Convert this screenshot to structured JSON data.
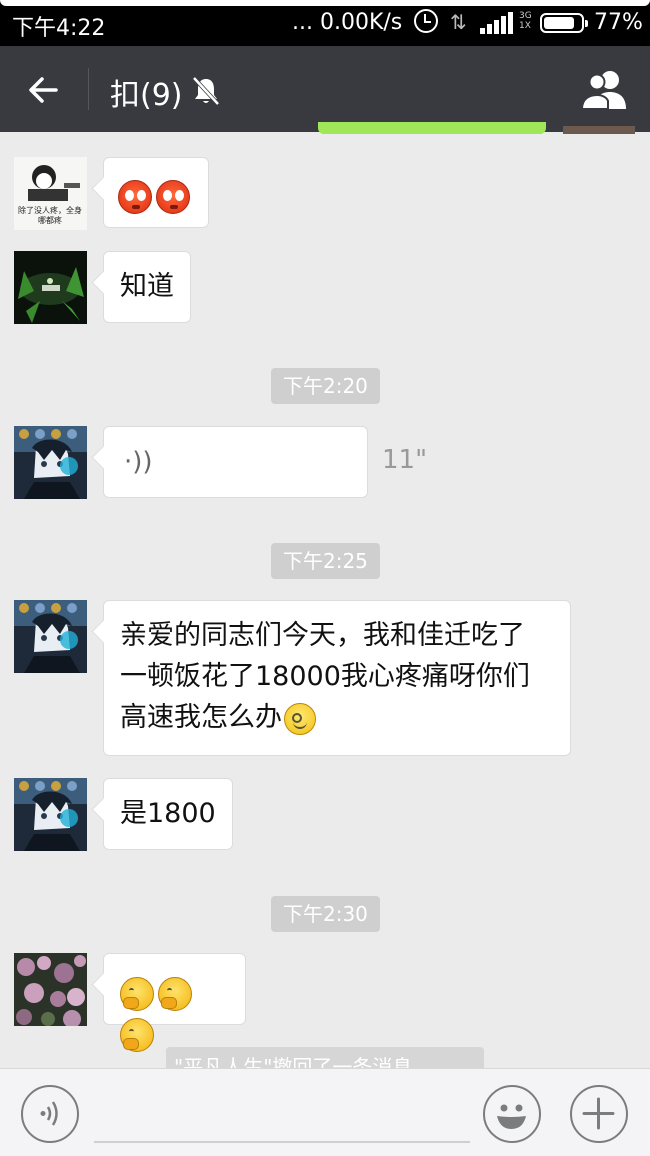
{
  "status_bar": {
    "time": "下午4:22",
    "network_speed": "... 0.00K/s",
    "network_type": "3G\n1X",
    "battery": "77%"
  },
  "header": {
    "title": "扣(9)",
    "back_icon": "back-arrow-icon",
    "mute_icon": "bell-muted-icon",
    "group_icon": "group-members-icon"
  },
  "messages": [
    {
      "type": "emoji",
      "emojis": [
        "blush-icon",
        "blush-icon"
      ],
      "avatar_caption": "除了没人疼，全身\n哪都疼"
    },
    {
      "type": "text",
      "text": "知道"
    },
    {
      "type": "timestamp",
      "text": "下午2:20"
    },
    {
      "type": "voice",
      "duration": "11\""
    },
    {
      "type": "timestamp",
      "text": "下午2:25"
    },
    {
      "type": "text",
      "lines": [
        "亲爱的同志们今天，我和佳迁吃了",
        "一顿饭花了18000我心疼痛呀你们",
        "高速我怎么办"
      ],
      "trailing_emoji": "smile-icon"
    },
    {
      "type": "text",
      "text": "是1800"
    },
    {
      "type": "timestamp",
      "text": "下午2:30"
    },
    {
      "type": "emoji",
      "emojis": [
        "thinking-icon",
        "thinking-icon",
        "thinking-icon"
      ]
    },
    {
      "type": "system",
      "text": "\"平凡人生\"撤回了一条消息"
    }
  ],
  "input_bar": {
    "voice_button": "voice-input-icon",
    "emoji_button": "emoji-face-icon",
    "plus_button": "plus-icon"
  },
  "colors": {
    "title_bar": "#393a3f",
    "chat_background": "#ebebeb",
    "bubble": "#ffffff",
    "timestamp_bg": "#cfcfcf"
  }
}
